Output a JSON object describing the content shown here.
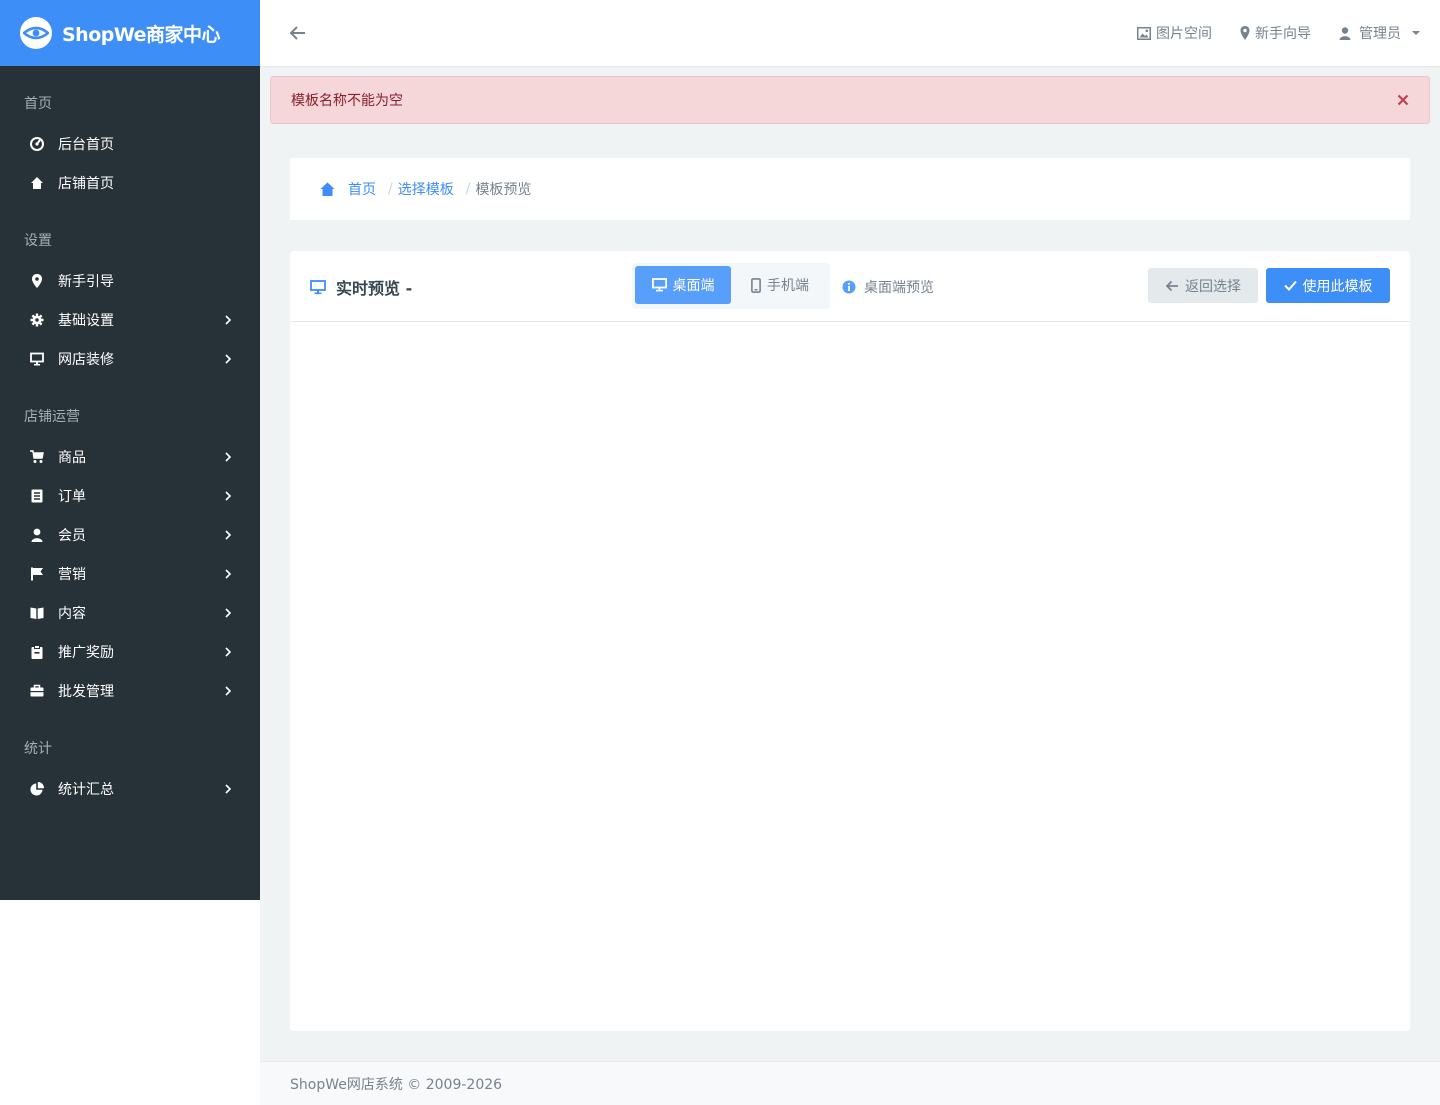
{
  "brand": {
    "name": "ShopWe商家中心",
    "color": "#3e8ef7"
  },
  "sidebar": {
    "sections": [
      {
        "title": "首页",
        "items": [
          {
            "label": "后台首页",
            "icon": "dashboard-icon"
          },
          {
            "label": "店铺首页",
            "icon": "home-icon"
          }
        ]
      },
      {
        "title": "设置",
        "items": [
          {
            "label": "新手引导",
            "icon": "map-pin-icon"
          },
          {
            "label": "基础设置",
            "icon": "gear-icon",
            "submenu": true
          },
          {
            "label": "网店装修",
            "icon": "monitor-icon",
            "submenu": true
          }
        ]
      },
      {
        "title": "店铺运营",
        "items": [
          {
            "label": "商品",
            "icon": "cart-icon",
            "submenu": true
          },
          {
            "label": "订单",
            "icon": "order-icon",
            "submenu": true
          },
          {
            "label": "会员",
            "icon": "user-icon",
            "submenu": true
          },
          {
            "label": "营销",
            "icon": "flag-icon",
            "submenu": true
          },
          {
            "label": "内容",
            "icon": "book-icon",
            "submenu": true
          },
          {
            "label": "推广奖励",
            "icon": "clipboard-icon",
            "submenu": true
          },
          {
            "label": "批发管理",
            "icon": "briefcase-icon",
            "submenu": true
          }
        ]
      },
      {
        "title": "统计",
        "items": [
          {
            "label": "统计汇总",
            "icon": "pie-chart-icon",
            "submenu": true
          }
        ]
      }
    ]
  },
  "topbar": {
    "links": {
      "images": "图片空间",
      "guide": "新手向导",
      "admin": "管理员"
    }
  },
  "alert": {
    "message": "模板名称不能为空"
  },
  "breadcrumb": {
    "home": "首页",
    "select": "选择模板",
    "current": "模板预览"
  },
  "panel": {
    "title": "实时预览 -",
    "desktop_label": "桌面端",
    "mobile_label": "手机端",
    "info_text": "桌面端预览",
    "back_label": "返回选择",
    "use_label": "使用此模板"
  },
  "footer": {
    "text": "ShopWe网店系统 © 2009-2026"
  }
}
